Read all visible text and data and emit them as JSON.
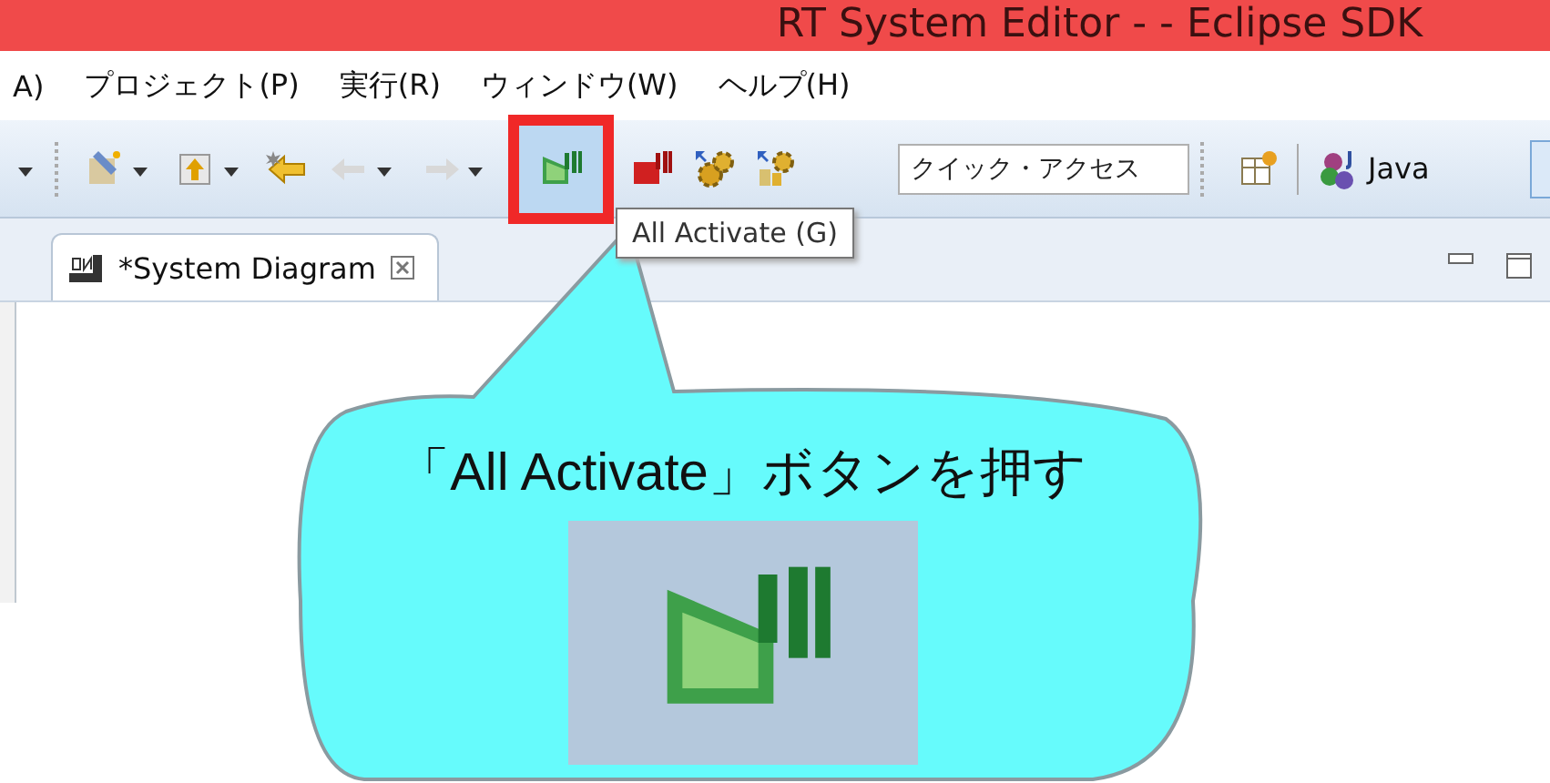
{
  "window": {
    "title": "RT System Editor -  - Eclipse SDK"
  },
  "menu": [
    {
      "label": "A)"
    },
    {
      "label": "プロジェクト(P)"
    },
    {
      "label": "実行(R)"
    },
    {
      "label": "ウィンドウ(W)"
    },
    {
      "label": "ヘルプ(H)"
    }
  ],
  "toolbar": {
    "buttons": [
      {
        "kind": "caret",
        "dropdown": false,
        "highlighted": false
      },
      {
        "kind": "wizard",
        "dropdown": true,
        "highlighted": false
      },
      {
        "kind": "upload",
        "dropdown": true,
        "highlighted": false
      },
      {
        "kind": "back-star",
        "dropdown": false,
        "highlighted": false
      },
      {
        "kind": "back",
        "dropdown": true,
        "highlighted": false
      },
      {
        "kind": "forward",
        "dropdown": true,
        "highlighted": false
      },
      {
        "kind": "activate-all",
        "dropdown": false,
        "highlighted": true
      },
      {
        "kind": "deactivate-all",
        "dropdown": false,
        "highlighted": false
      },
      {
        "kind": "gears",
        "dropdown": false,
        "highlighted": false
      },
      {
        "kind": "gears-box",
        "dropdown": false,
        "highlighted": false
      }
    ],
    "quick_access": {
      "placeholder": "クイック・アクセス"
    },
    "perspective": {
      "label": "Java"
    }
  },
  "tooltip": {
    "text": "All Activate (G)"
  },
  "editor_tabs": [
    {
      "label": "*System Diagram",
      "selected": true
    }
  ],
  "callout": {
    "text": "「All Activate」ボタンを押す"
  }
}
